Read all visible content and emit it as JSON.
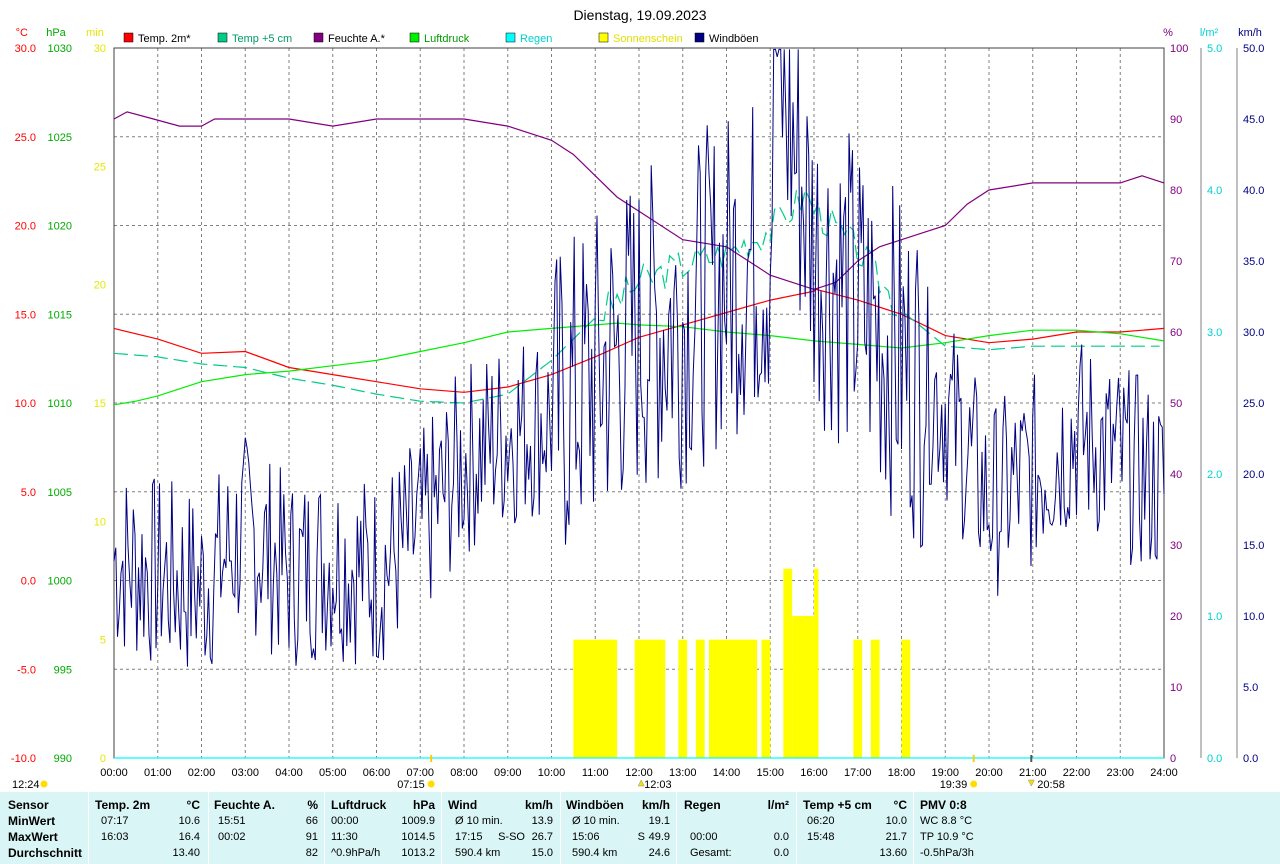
{
  "chart_data": {
    "type": "line",
    "title": "Dienstag, 19.09.2023",
    "legend": [
      {
        "name": "Temp. 2m*",
        "color": "#ff0000"
      },
      {
        "name": "Temp +5 cm",
        "color": "#00cc88"
      },
      {
        "name": "Feuchte A.*",
        "color": "#800080"
      },
      {
        "name": "Luftdruck",
        "color": "#00ee00"
      },
      {
        "name": "Regen",
        "color": "#00ffff"
      },
      {
        "name": "Sonnenschein",
        "color": "#ffff00"
      },
      {
        "name": "Windböen",
        "color": "#000080"
      }
    ],
    "axes": {
      "temp": {
        "unit": "°C",
        "range": [
          -10,
          30
        ],
        "ticks": [
          "30.0",
          "25.0",
          "20.0",
          "15.0",
          "10.0",
          "5.0",
          "0.0",
          "-5.0",
          "-10.0"
        ]
      },
      "pressure": {
        "unit": "hPa",
        "range": [
          990,
          1030
        ],
        "ticks": [
          "1030",
          "1025",
          "1020",
          "1015",
          "1010",
          "1005",
          "1000",
          "995",
          "990"
        ]
      },
      "sunshine": {
        "unit": "min",
        "range": [
          0,
          30
        ],
        "ticks": [
          "30",
          "25",
          "20",
          "15",
          "10",
          "5",
          "0"
        ]
      },
      "humidity": {
        "unit": "%",
        "range": [
          0,
          100
        ],
        "ticks": [
          "100",
          "90",
          "80",
          "70",
          "60",
          "50",
          "40",
          "30",
          "20",
          "10",
          "0"
        ]
      },
      "rain": {
        "unit": "l/m²",
        "range": [
          0,
          5
        ],
        "ticks": [
          "5.0",
          "4.0",
          "3.0",
          "2.0",
          "1.0",
          "0.0"
        ]
      },
      "wind": {
        "unit": "km/h",
        "range": [
          0,
          50
        ],
        "ticks": [
          "50.0",
          "45.0",
          "40.0",
          "35.0",
          "30.0",
          "25.0",
          "20.0",
          "15.0",
          "10.0",
          "5.0",
          "0.0"
        ]
      },
      "time": {
        "ticks": [
          "00:00",
          "01:00",
          "02:00",
          "03:00",
          "04:00",
          "05:00",
          "06:00",
          "07:00",
          "08:00",
          "09:00",
          "10:00",
          "11:00",
          "12:00",
          "13:00",
          "14:00",
          "15:00",
          "16:00",
          "17:00",
          "18:00",
          "19:00",
          "20:00",
          "21:00",
          "22:00",
          "23:00",
          "24:00"
        ]
      }
    },
    "time_markers": {
      "moonrise": "07:15",
      "sun_noon": "12:03",
      "sunset": "19:39",
      "moonset": "20:58",
      "moon_prev": "12:24"
    },
    "series": [
      {
        "name": "Temp. 2m*",
        "axis": "temp",
        "x": [
          0,
          1,
          2,
          3,
          4,
          5,
          6,
          7,
          8,
          9,
          10,
          11,
          12,
          13,
          14,
          15,
          16,
          16.05,
          17,
          18,
          19,
          20,
          21,
          22,
          23,
          24
        ],
        "values": [
          14.2,
          13.6,
          12.8,
          12.9,
          12.0,
          11.6,
          11.2,
          10.8,
          10.6,
          10.9,
          11.6,
          12.6,
          13.7,
          14.4,
          15.1,
          15.8,
          16.3,
          16.4,
          15.8,
          15.0,
          13.8,
          13.4,
          13.6,
          14.0,
          14.0,
          14.2
        ]
      },
      {
        "name": "Temp +5 cm",
        "axis": "temp",
        "x": [
          0,
          1,
          2,
          3,
          4,
          5,
          6,
          7,
          8,
          9,
          10,
          11,
          12,
          13,
          14,
          15,
          15.8,
          16,
          17,
          18,
          19,
          20,
          21,
          22,
          23,
          24
        ],
        "values": [
          12.8,
          12.6,
          12.2,
          12.0,
          11.4,
          11.0,
          10.5,
          10.1,
          10.0,
          10.5,
          12.4,
          14.8,
          16.8,
          17.8,
          18.5,
          19.8,
          21.7,
          21.0,
          18.6,
          15.2,
          13.2,
          13.0,
          13.2,
          13.2,
          13.2,
          13.2
        ]
      },
      {
        "name": "Feuchte A.*",
        "axis": "humidity",
        "x": [
          0,
          0.3,
          0.9,
          1.5,
          2,
          2.3,
          3,
          4,
          5,
          6,
          7,
          8,
          9,
          10,
          10.5,
          11,
          11.5,
          12,
          12.5,
          13,
          14,
          14.5,
          15,
          15.5,
          16,
          16.5,
          17,
          17.5,
          18,
          18.5,
          19,
          19.5,
          20,
          21,
          22,
          23,
          23.5,
          24
        ],
        "values": [
          90,
          91,
          90,
          89,
          89,
          90,
          90,
          90,
          89,
          90,
          90,
          90,
          89,
          87,
          85,
          82,
          79,
          77,
          75,
          73,
          72,
          70,
          68,
          67,
          66,
          67,
          70,
          72,
          73,
          74,
          75,
          78,
          80,
          81,
          81,
          81,
          82,
          81
        ]
      },
      {
        "name": "Luftdruck",
        "axis": "pressure",
        "x": [
          0,
          0.5,
          1,
          2,
          3,
          4,
          5,
          6,
          7,
          8,
          9,
          10,
          11,
          11.5,
          12,
          13,
          14,
          15,
          16,
          17,
          18,
          19,
          20,
          21,
          22,
          23,
          24
        ],
        "values": [
          1009.9,
          1010.1,
          1010.4,
          1011.2,
          1011.6,
          1011.8,
          1012.1,
          1012.4,
          1012.9,
          1013.4,
          1014.0,
          1014.2,
          1014.4,
          1014.5,
          1014.4,
          1014.3,
          1014.0,
          1013.8,
          1013.5,
          1013.3,
          1013.1,
          1013.4,
          1013.8,
          1014.1,
          1014.1,
          1013.9,
          1013.5
        ]
      },
      {
        "name": "Regen",
        "axis": "rain",
        "x": [
          0,
          24
        ],
        "values": [
          0,
          0
        ]
      },
      {
        "name": "Windböen",
        "axis": "wind",
        "x": [
          0,
          1,
          2,
          3,
          4,
          5,
          6,
          7,
          8,
          9,
          10,
          11,
          12,
          13,
          14,
          15,
          15.1,
          16,
          17,
          18,
          19,
          20,
          21,
          22,
          23,
          24
        ],
        "values": [
          14,
          13,
          12,
          16,
          13,
          14,
          13,
          16,
          21,
          23,
          24,
          27,
          30,
          31,
          34,
          36,
          49.9,
          36,
          32,
          28,
          25,
          18,
          20,
          23,
          21,
          19
        ]
      }
    ],
    "sunshine_bars": [
      {
        "from": 10.5,
        "to": 11.5,
        "min": 5
      },
      {
        "from": 11.9,
        "to": 12.6,
        "min": 5
      },
      {
        "from": 12.9,
        "to": 13.1,
        "min": 5
      },
      {
        "from": 13.3,
        "to": 13.5,
        "min": 5
      },
      {
        "from": 13.6,
        "to": 14.7,
        "min": 5
      },
      {
        "from": 14.8,
        "to": 15.0,
        "min": 5
      },
      {
        "from": 15.3,
        "to": 15.5,
        "min": 8
      },
      {
        "from": 15.5,
        "to": 16.1,
        "min": 6
      },
      {
        "from": 16.0,
        "to": 16.1,
        "min": 8
      },
      {
        "from": 16.9,
        "to": 17.1,
        "min": 5
      },
      {
        "from": 17.3,
        "to": 17.5,
        "min": 5
      },
      {
        "from": 18.0,
        "to": 18.2,
        "min": 5
      }
    ]
  },
  "stats": {
    "headers": {
      "sensor": "Sensor",
      "temp2m": "Temp. 2m",
      "temp2m_unit": "°C",
      "humidity": "Feuchte A.",
      "humidity_unit": "%",
      "pressure": "Luftdruck",
      "pressure_unit": "hPa",
      "wind": "Wind",
      "wind_unit": "km/h",
      "gusts": "Windböen",
      "gusts_unit": "km/h",
      "rain": "Regen",
      "rain_unit": "l/m²",
      "temp5": "Temp +5 cm",
      "temp5_unit": "°C",
      "pmv": "PMV 0:8"
    },
    "rows": [
      "MinWert",
      "MaxWert",
      "Durchschnitt"
    ],
    "temp2m": [
      [
        "07:17",
        "10.6"
      ],
      [
        "16:03",
        "16.4"
      ],
      [
        "",
        "13.40"
      ]
    ],
    "humidity": [
      [
        "15:51",
        "66"
      ],
      [
        "00:02",
        "91"
      ],
      [
        "",
        "82"
      ]
    ],
    "pressure": [
      [
        "00:00",
        "1009.9"
      ],
      [
        "11:30",
        "1014.5"
      ],
      [
        "^0.9hPa/h",
        "1013.2"
      ]
    ],
    "wind": [
      [
        "Ø 10 min.",
        "",
        "13.9"
      ],
      [
        "17:15",
        "S-SO",
        "26.7"
      ],
      [
        "590.4 km",
        "",
        "15.0"
      ]
    ],
    "gusts": [
      [
        "Ø 10 min.",
        "",
        "19.1"
      ],
      [
        "15:06",
        "S",
        "49.9"
      ],
      [
        "590.4 km",
        "",
        "24.6"
      ]
    ],
    "rain": [
      [
        "",
        "",
        ""
      ],
      [
        "00:00",
        "",
        "0.0"
      ],
      [
        "Gesamt:",
        "",
        "0.0"
      ]
    ],
    "temp5": [
      [
        "06:20",
        "10.0"
      ],
      [
        "15:48",
        "21.7"
      ],
      [
        "",
        "13.60"
      ]
    ],
    "pmv": [
      "WC 8.8 °C",
      "TP 10.9 °C",
      "-0.5hPa/3h"
    ]
  }
}
